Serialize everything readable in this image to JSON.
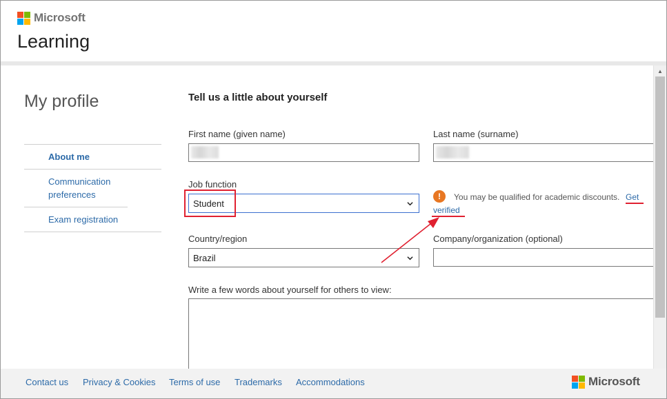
{
  "header": {
    "brand": "Microsoft",
    "app_title": "Learning"
  },
  "sidebar": {
    "title": "My profile",
    "items": [
      {
        "label": "About me",
        "active": true
      },
      {
        "label": "Communication preferences",
        "active": false
      },
      {
        "label": "Exam registration",
        "active": false
      }
    ]
  },
  "form": {
    "heading": "Tell us a little about yourself",
    "first_name_label": "First name (given name)",
    "last_name_label": "Last name (surname)",
    "job_function_label": "Job function",
    "job_function_value": "Student",
    "country_label": "Country/region",
    "country_value": "Brazil",
    "company_label": "Company/organization (optional)",
    "about_label": "Write a few words about yourself for others to view:",
    "notice_text": "You may be qualified for academic discounts.",
    "notice_link_part1": "Get",
    "notice_link_part2": "verified"
  },
  "footer": {
    "links": [
      "Contact us",
      "Privacy & Cookies",
      "Terms of use",
      "Trademarks",
      "Accommodations"
    ],
    "brand": "Microsoft"
  },
  "colors": {
    "link": "#2c6aa8",
    "annotation_red": "#e02030",
    "warning_orange": "#e87722",
    "ms_red": "#f25022",
    "ms_green": "#7fba00",
    "ms_blue": "#00a4ef",
    "ms_yellow": "#ffb900"
  }
}
